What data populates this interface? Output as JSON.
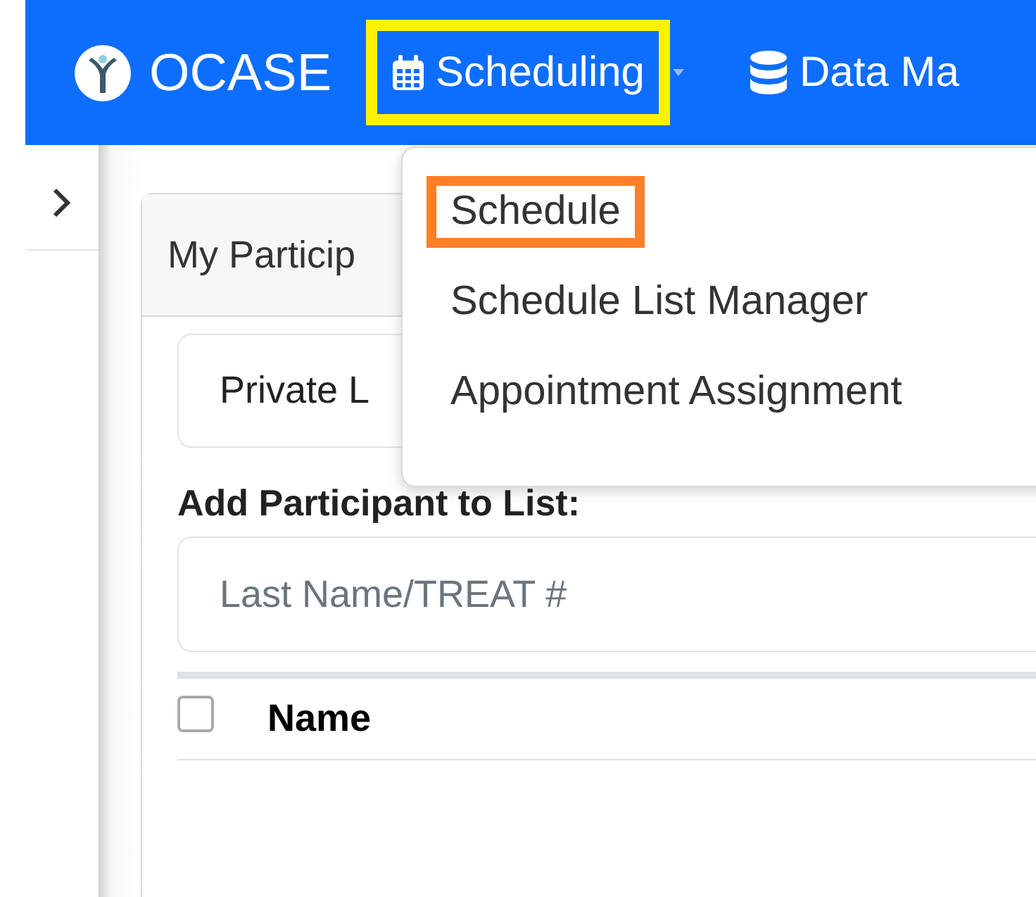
{
  "brand": {
    "name": "OCASE"
  },
  "nav": [
    {
      "label": "Scheduling",
      "kind": "calendar",
      "has_caret": true,
      "highlighted": true,
      "color": "#fff200"
    },
    {
      "label": "Data Ma",
      "kind": "database",
      "has_caret": false,
      "highlighted": false
    }
  ],
  "menu": {
    "items": [
      {
        "label": "Schedule",
        "highlighted": true,
        "color": "#ff7f27"
      },
      {
        "label": "Schedule List Manager",
        "highlighted": false
      },
      {
        "label": "Appointment Assignment",
        "highlighted": false
      }
    ]
  },
  "card": {
    "tab": "My Particip",
    "list_select": {
      "value": "Private L"
    },
    "add_label": "Add Participant to List:",
    "search": {
      "placeholder": "Last Name/TREAT #"
    },
    "table": {
      "select_all_checked": false,
      "columns": [
        "Name"
      ]
    }
  }
}
